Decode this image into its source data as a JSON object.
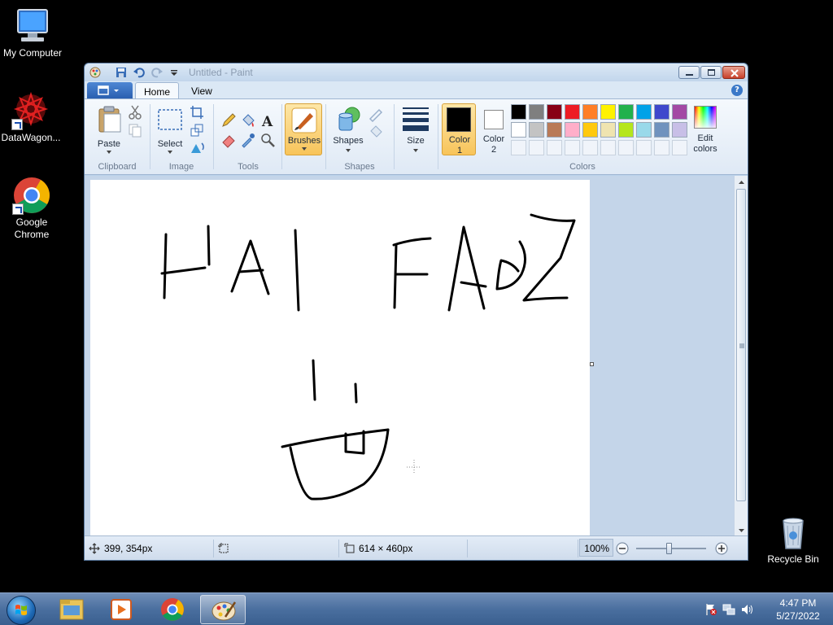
{
  "desktop": {
    "icons": [
      {
        "label": "My Computer"
      },
      {
        "label": "DataWagon..."
      },
      {
        "label": "Google Chrome"
      },
      {
        "label": "Recycle Bin"
      }
    ]
  },
  "window": {
    "title": "Untitled - Paint",
    "tabs": [
      "Home",
      "View"
    ],
    "ribbon": {
      "clipboard": {
        "paste_label": "Paste",
        "group": "Clipboard"
      },
      "image": {
        "select_label": "Select",
        "group": "Image"
      },
      "tools": {
        "group": "Tools"
      },
      "brushes_label": "Brushes",
      "shapes": {
        "shapes_label": "Shapes",
        "group": "Shapes"
      },
      "size_label": "Size",
      "color1_label": "Color",
      "color1_num": "1",
      "color2_label": "Color",
      "color2_num": "2",
      "colors_group": "Colors",
      "edit_colors_label": "Edit",
      "edit_colors_label2": "colors",
      "palette_row1": [
        "#000000",
        "#7f7f7f",
        "#880015",
        "#ed1c24",
        "#ff7f27",
        "#fff200",
        "#22b14c",
        "#00a2e8",
        "#3f48cc",
        "#a349a4"
      ],
      "palette_row2": [
        "#ffffff",
        "#c3c3c3",
        "#b97a57",
        "#ffaec9",
        "#ffc90e",
        "#efe4b0",
        "#b5e61d",
        "#99d9ea",
        "#7092be",
        "#c8bfe7"
      ],
      "color1_value": "#000000",
      "color2_value": "#ffffff"
    },
    "canvas": {
      "drawing_text": "HAI FAGZ"
    },
    "status": {
      "cursor_pos": "399, 354px",
      "canvas_size": "614 × 460px",
      "zoom": "100%"
    }
  },
  "taskbar": {
    "time": "4:47 PM",
    "date": "5/27/2022"
  }
}
